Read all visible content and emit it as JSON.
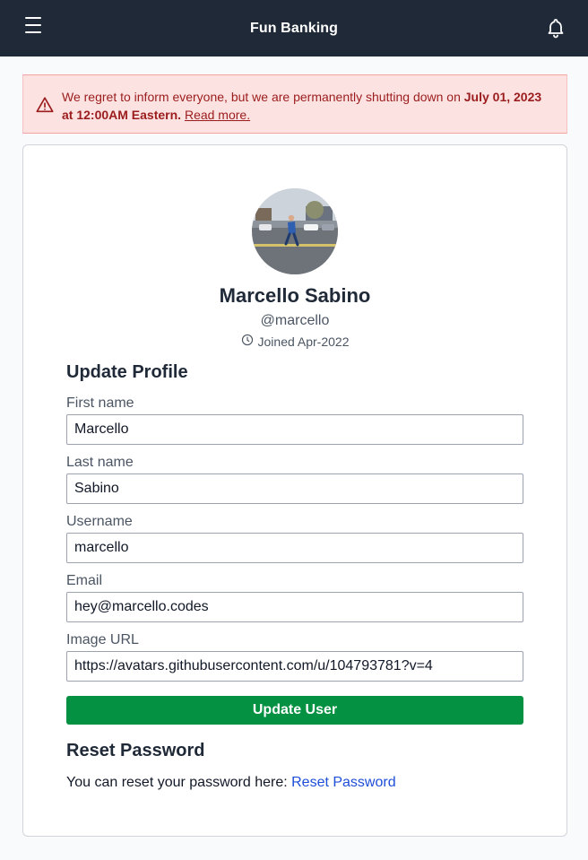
{
  "header": {
    "title": "Fun Banking",
    "menu_icon": "hamburger-menu-icon",
    "notification_icon": "bell-icon"
  },
  "alert": {
    "icon": "warning-triangle-icon",
    "message": "We regret to inform everyone, but we are permanently shutting down on ",
    "date_text": "July 01, 2023 at 12:00AM Eastern.",
    "link_label": "Read more.",
    "color": "#9b1c1c",
    "background": "#fde2e2"
  },
  "profile": {
    "name": "Marcello Sabino",
    "username": "@marcello",
    "joined": "Joined Apr-2022",
    "joined_icon": "clock-icon"
  },
  "update_profile": {
    "title": "Update Profile",
    "fields": [
      {
        "label": "First name",
        "value": "Marcello"
      },
      {
        "label": "Last name",
        "value": "Sabino"
      },
      {
        "label": "Username",
        "value": "marcello"
      },
      {
        "label": "Email",
        "value": "hey@marcello.codes"
      },
      {
        "label": "Image URL",
        "value": "https://avatars.githubusercontent.com/u/104793781?v=4"
      }
    ],
    "submit_label": "Update User",
    "submit_color": "#059142"
  },
  "reset_password": {
    "title": "Reset Password",
    "text": "You can reset your password here: ",
    "link_label": "Reset Password",
    "link_color": "#1d4ed8"
  }
}
